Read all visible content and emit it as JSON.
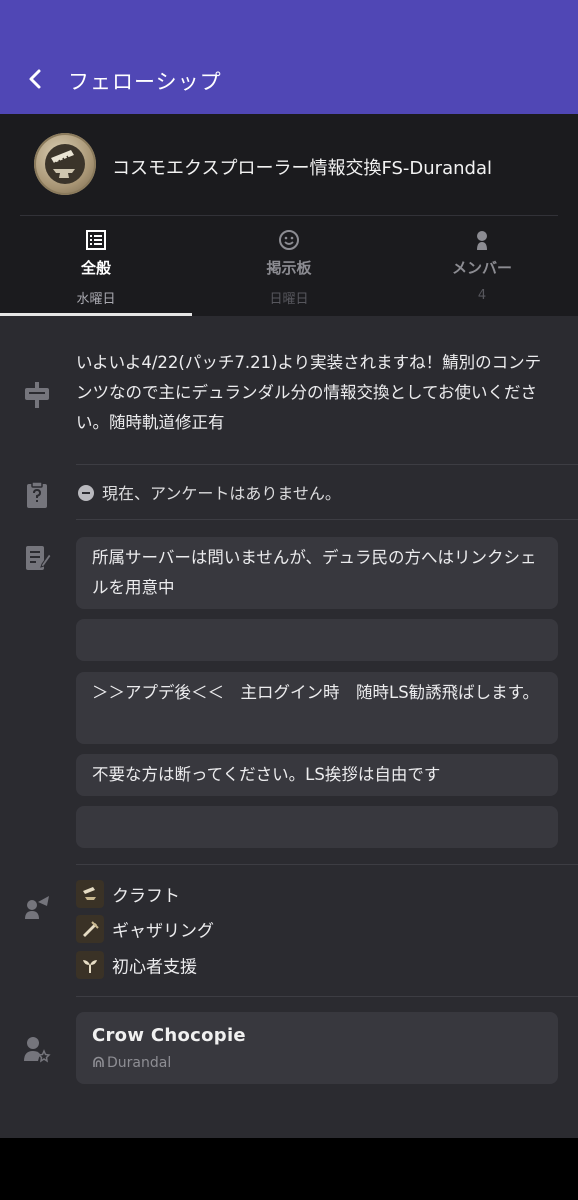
{
  "header": {
    "back_icon": "chevron-left-icon",
    "title": "フェローシップ"
  },
  "fellowship": {
    "name": "コスモエクスプローラー情報交換FS-Durandal",
    "crest_icon": "anvil-crest-icon"
  },
  "tabs": [
    {
      "label": "全般",
      "sub": "水曜日",
      "icon": "list-icon",
      "active": true
    },
    {
      "label": "掲示板",
      "sub": "日曜日",
      "icon": "smiley-icon",
      "active": false
    },
    {
      "label": "メンバー",
      "sub": "4",
      "icon": "person-icon",
      "active": false
    }
  ],
  "description": "いよいよ4/22(パッチ7.21)より実装されますね！鯖別のコンテンツなので主にデュランダル分の情報交換としてお使いください。随時軌道修正有",
  "survey": {
    "text": "現在、アンケートはありません。"
  },
  "notes": [
    "所属サーバーは問いませんが、デュラ民の方へはリンクシェルを用意中",
    "",
    "＞＞アプデ後＜＜　主ログイン時　随時LS勧誘飛ばします。",
    "不要な方は断ってください。LS挨拶は自由です",
    ""
  ],
  "tags": [
    {
      "label": "クラフト",
      "icon": "craft-icon"
    },
    {
      "label": "ギャザリング",
      "icon": "gathering-icon"
    },
    {
      "label": "初心者支援",
      "icon": "sprout-icon"
    }
  ],
  "leader": {
    "name": "Crow Chocopie",
    "world": "Durandal"
  },
  "colors": {
    "topbar": "#5047b5",
    "header_bg": "#1b1b1e",
    "body_bg": "#2b2b30",
    "card_bg": "#38383e"
  }
}
